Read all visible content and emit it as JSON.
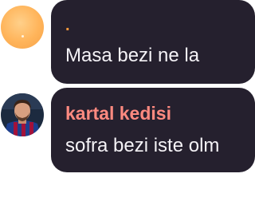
{
  "messages": [
    {
      "sender": ".",
      "text": "Masa bezi ne la",
      "sender_color": "#ff9a3c",
      "avatar": "orange-default-avatar"
    },
    {
      "sender": "kartal kedisi",
      "text": "sofra bezi iste olm",
      "sender_color": "#ff8a80",
      "avatar": "football-player-photo"
    }
  ],
  "colors": {
    "bubble_background": "#25202e",
    "message_text": "#f4f2f6",
    "page_background": "#ffffff"
  }
}
